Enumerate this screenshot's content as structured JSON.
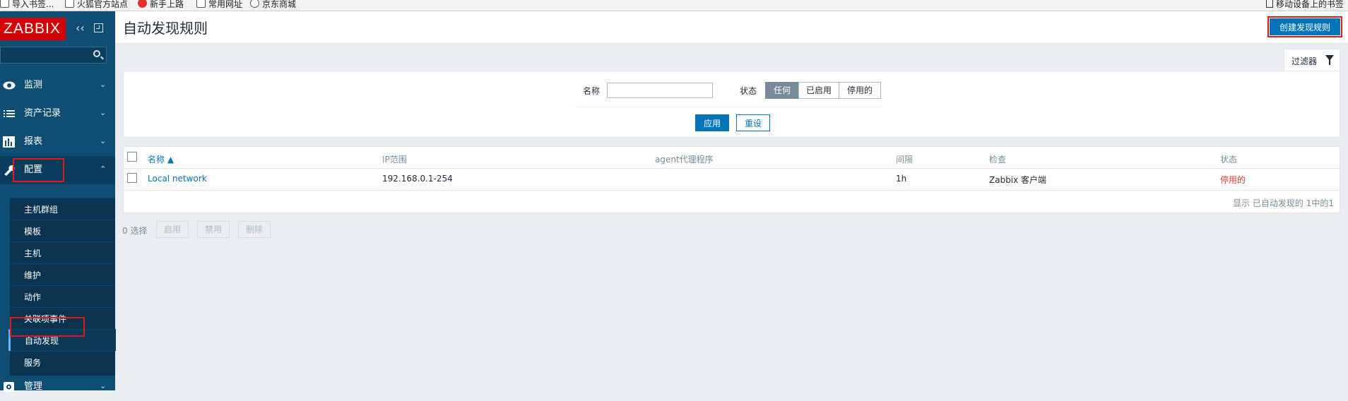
{
  "bookmarks": {
    "items": [
      {
        "label": "导入书签...",
        "icon": "bookmark-icon"
      },
      {
        "label": "火狐官方站点",
        "icon": "folder-icon"
      },
      {
        "label": "新手上路",
        "icon": "firefox-icon"
      },
      {
        "label": "常用网址",
        "icon": "folder-icon"
      },
      {
        "label": "京东商城",
        "icon": "globe-icon"
      }
    ],
    "right_label": "移动设备上的书签"
  },
  "sidebar": {
    "logo": "ZABBIX",
    "collapse_icon": "double-chevron-left-icon",
    "kiosk_icon": "fullscreen-icon",
    "search_icon": "search-icon",
    "menu": [
      {
        "label": "监测",
        "icon": "eye-icon"
      },
      {
        "label": "资产记录",
        "icon": "list-icon"
      },
      {
        "label": "报表",
        "icon": "bar-chart-icon"
      },
      {
        "label": "配置",
        "icon": "wrench-icon"
      },
      {
        "label": "管理",
        "icon": "gear-icon"
      }
    ],
    "submenu": [
      {
        "label": "主机群组"
      },
      {
        "label": "模板"
      },
      {
        "label": "主机"
      },
      {
        "label": "维护"
      },
      {
        "label": "动作"
      },
      {
        "label": "关联项事件"
      },
      {
        "label": "自动发现"
      },
      {
        "label": "服务"
      }
    ]
  },
  "header": {
    "title": "自动发现规则",
    "create_button": "创建发现规则"
  },
  "filter": {
    "tab_label": "过滤器",
    "name_label": "名称",
    "name_value": "",
    "status_label": "状态",
    "status_options": [
      "任何",
      "已启用",
      "停用的"
    ],
    "status_selected": "任何",
    "apply": "应用",
    "reset": "重设"
  },
  "table": {
    "columns": {
      "name": "名称 ▲",
      "ip_range": "IP范围",
      "proxy": "agent代理程序",
      "interval": "间隔",
      "checks": "检查",
      "status": "状态"
    },
    "rows": [
      {
        "name": "Local network",
        "ip_range": "192.168.0.1-254",
        "proxy": "",
        "interval": "1h",
        "checks": "Zabbix 客户端",
        "status": "停用的"
      }
    ],
    "footer": "显示 已自动发现的 1中的1"
  },
  "actions": {
    "selected_count": "0 选择",
    "enable": "启用",
    "disable": "禁用",
    "delete": "删除"
  },
  "colors": {
    "sidebar_bg": "#0f4d73",
    "primary": "#0275b8",
    "danger": "#e33734",
    "logo_red": "#d40000",
    "highlight_box": "#e0191f"
  }
}
